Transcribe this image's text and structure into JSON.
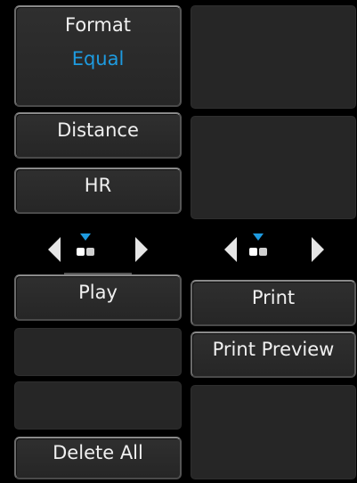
{
  "left_panel": {
    "format_label": "Format",
    "format_value": "Equal",
    "distance_label": "Distance",
    "hr_label": "HR",
    "play_label": "Play",
    "delete_all_label": "Delete All"
  },
  "right_panel": {
    "print_label": "Print",
    "print_preview_label": "Print Preview"
  },
  "icons": {
    "page_left": "triangle-left-icon",
    "page_indicator": "page-indicator-icon",
    "page_right": "triangle-right-icon"
  },
  "colors": {
    "accent": "#1e9be0",
    "background": "#000000",
    "button_face": "#2a2a2a"
  }
}
